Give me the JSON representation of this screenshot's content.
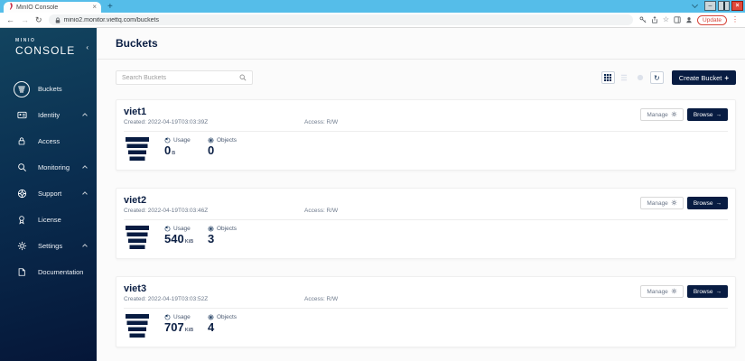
{
  "browser": {
    "tab_title": "MinIO Console",
    "url": "minio2.monitor.viettq.com/buckets",
    "update_label": "Update"
  },
  "glyphs": {
    "back": "←",
    "forward": "→",
    "reload": "↻",
    "star": "☆",
    "menu_dots": "⋮",
    "tab_close": "×",
    "new_tab": "+",
    "win_min": "–",
    "win_close": "×",
    "collapse": "‹",
    "refresh": "↻",
    "browse_arrow": "→",
    "plus": "+"
  },
  "sidebar": {
    "brand_top": "MINIO",
    "brand_bottom": "CONSOLE",
    "items": [
      {
        "label": "Buckets"
      },
      {
        "label": "Identity"
      },
      {
        "label": "Access"
      },
      {
        "label": "Monitoring"
      },
      {
        "label": "Support"
      },
      {
        "label": "License"
      },
      {
        "label": "Settings"
      },
      {
        "label": "Documentation"
      }
    ]
  },
  "page": {
    "title": "Buckets",
    "search_placeholder": "Search Buckets",
    "create_label": "Create Bucket"
  },
  "labels": {
    "usage": "Usage",
    "objects": "Objects",
    "manage": "Manage",
    "browse": "Browse"
  },
  "buckets": [
    {
      "name": "viet1",
      "created": "Created: 2022-04-19T03:03:39Z",
      "access": "Access: R/W",
      "usage_value": "0",
      "usage_unit": "B",
      "objects": "0"
    },
    {
      "name": "viet2",
      "created": "Created: 2022-04-19T03:03:46Z",
      "access": "Access: R/W",
      "usage_value": "540",
      "usage_unit": "KiB",
      "objects": "3"
    },
    {
      "name": "viet3",
      "created": "Created: 2022-04-19T03:03:52Z",
      "access": "Access: R/W",
      "usage_value": "707",
      "usage_unit": "KiB",
      "objects": "4"
    }
  ],
  "colors": {
    "navy": "#081C42",
    "titlebar_blue": "#55BDE9",
    "update_red": "#D7453A",
    "minio_red": "#C72C48"
  }
}
